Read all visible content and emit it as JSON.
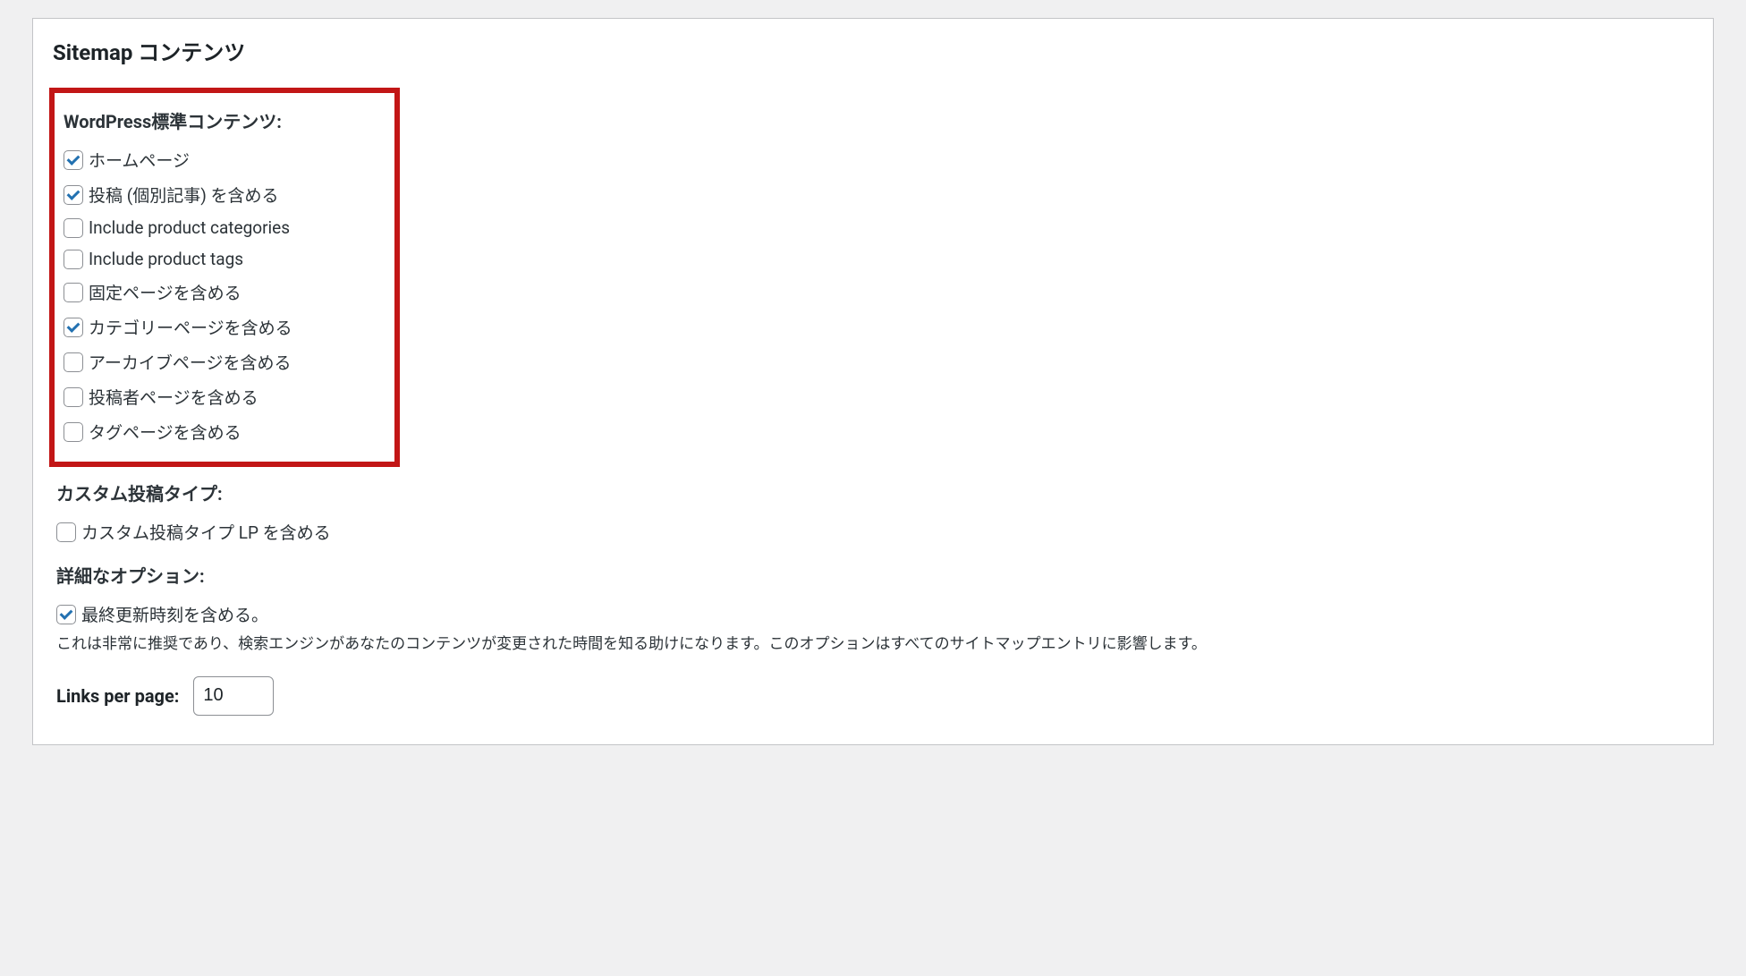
{
  "panel": {
    "title": "Sitemap コンテンツ"
  },
  "standard": {
    "heading": "WordPress標準コンテンツ:",
    "items": [
      {
        "label": "ホームページ",
        "checked": true
      },
      {
        "label": "投稿 (個別記事) を含める",
        "checked": true
      },
      {
        "label": "Include product categories",
        "checked": false
      },
      {
        "label": "Include product tags",
        "checked": false
      },
      {
        "label": "固定ページを含める",
        "checked": false
      },
      {
        "label": "カテゴリーページを含める",
        "checked": true
      },
      {
        "label": "アーカイブページを含める",
        "checked": false
      },
      {
        "label": "投稿者ページを含める",
        "checked": false
      },
      {
        "label": "タグページを含める",
        "checked": false
      }
    ]
  },
  "custom": {
    "heading": "カスタム投稿タイプ:",
    "items": [
      {
        "label": "カスタム投稿タイプ LP を含める",
        "checked": false
      }
    ]
  },
  "advanced": {
    "heading": "詳細なオプション:",
    "items": [
      {
        "label": "最終更新時刻を含める。",
        "checked": true
      }
    ],
    "description": "これは非常に推奨であり、検索エンジンがあなたのコンテンツが変更された時間を知る助けになります。このオプションはすべてのサイトマップエントリに影響します。"
  },
  "links": {
    "label": "Links per page:",
    "value": "10"
  }
}
